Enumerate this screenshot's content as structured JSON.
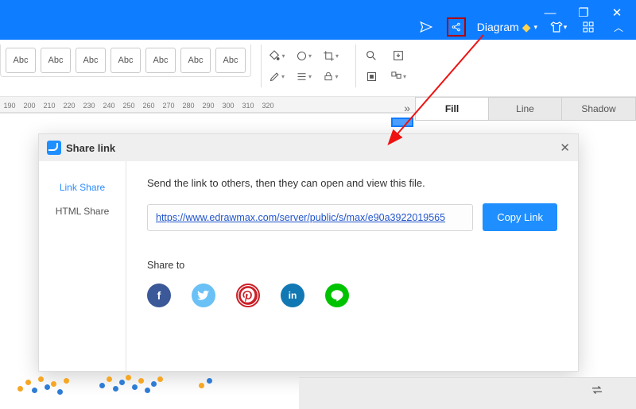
{
  "titlebar": {
    "diagram_label": "Diagram",
    "win": {
      "min": "—",
      "max": "❐",
      "close": "✕"
    }
  },
  "abc": [
    "Abc",
    "Abc",
    "Abc",
    "Abc",
    "Abc",
    "Abc",
    "Abc"
  ],
  "ruler_ticks": [
    190,
    200,
    210,
    220,
    230,
    240,
    250,
    260,
    270,
    280,
    290,
    300,
    310,
    320
  ],
  "right_tabs": {
    "fill": "Fill",
    "line": "Line",
    "shadow": "Shadow"
  },
  "tools": {
    "paint": "◆",
    "shape": "◯",
    "crop": "⟂",
    "pen": "✎",
    "lines": "≣",
    "lock": "🔒",
    "search": "🔍",
    "import": "⍞",
    "sel": "▣",
    "arrange": "▦"
  },
  "modal": {
    "title": "Share link",
    "close": "✕",
    "side": {
      "link": "Link Share",
      "html": "HTML Share"
    },
    "instruction": "Send the link to others, then they can open and view this file.",
    "url": "https://www.edrawmax.com/server/public/s/max/e90a3922019565",
    "copy": "Copy Link",
    "shareto": "Share to",
    "socials": {
      "fb": "f",
      "tw": "🐦",
      "pin": "𝒑",
      "li": "in",
      "line": "LINE"
    }
  },
  "br_ctl": "⇄"
}
